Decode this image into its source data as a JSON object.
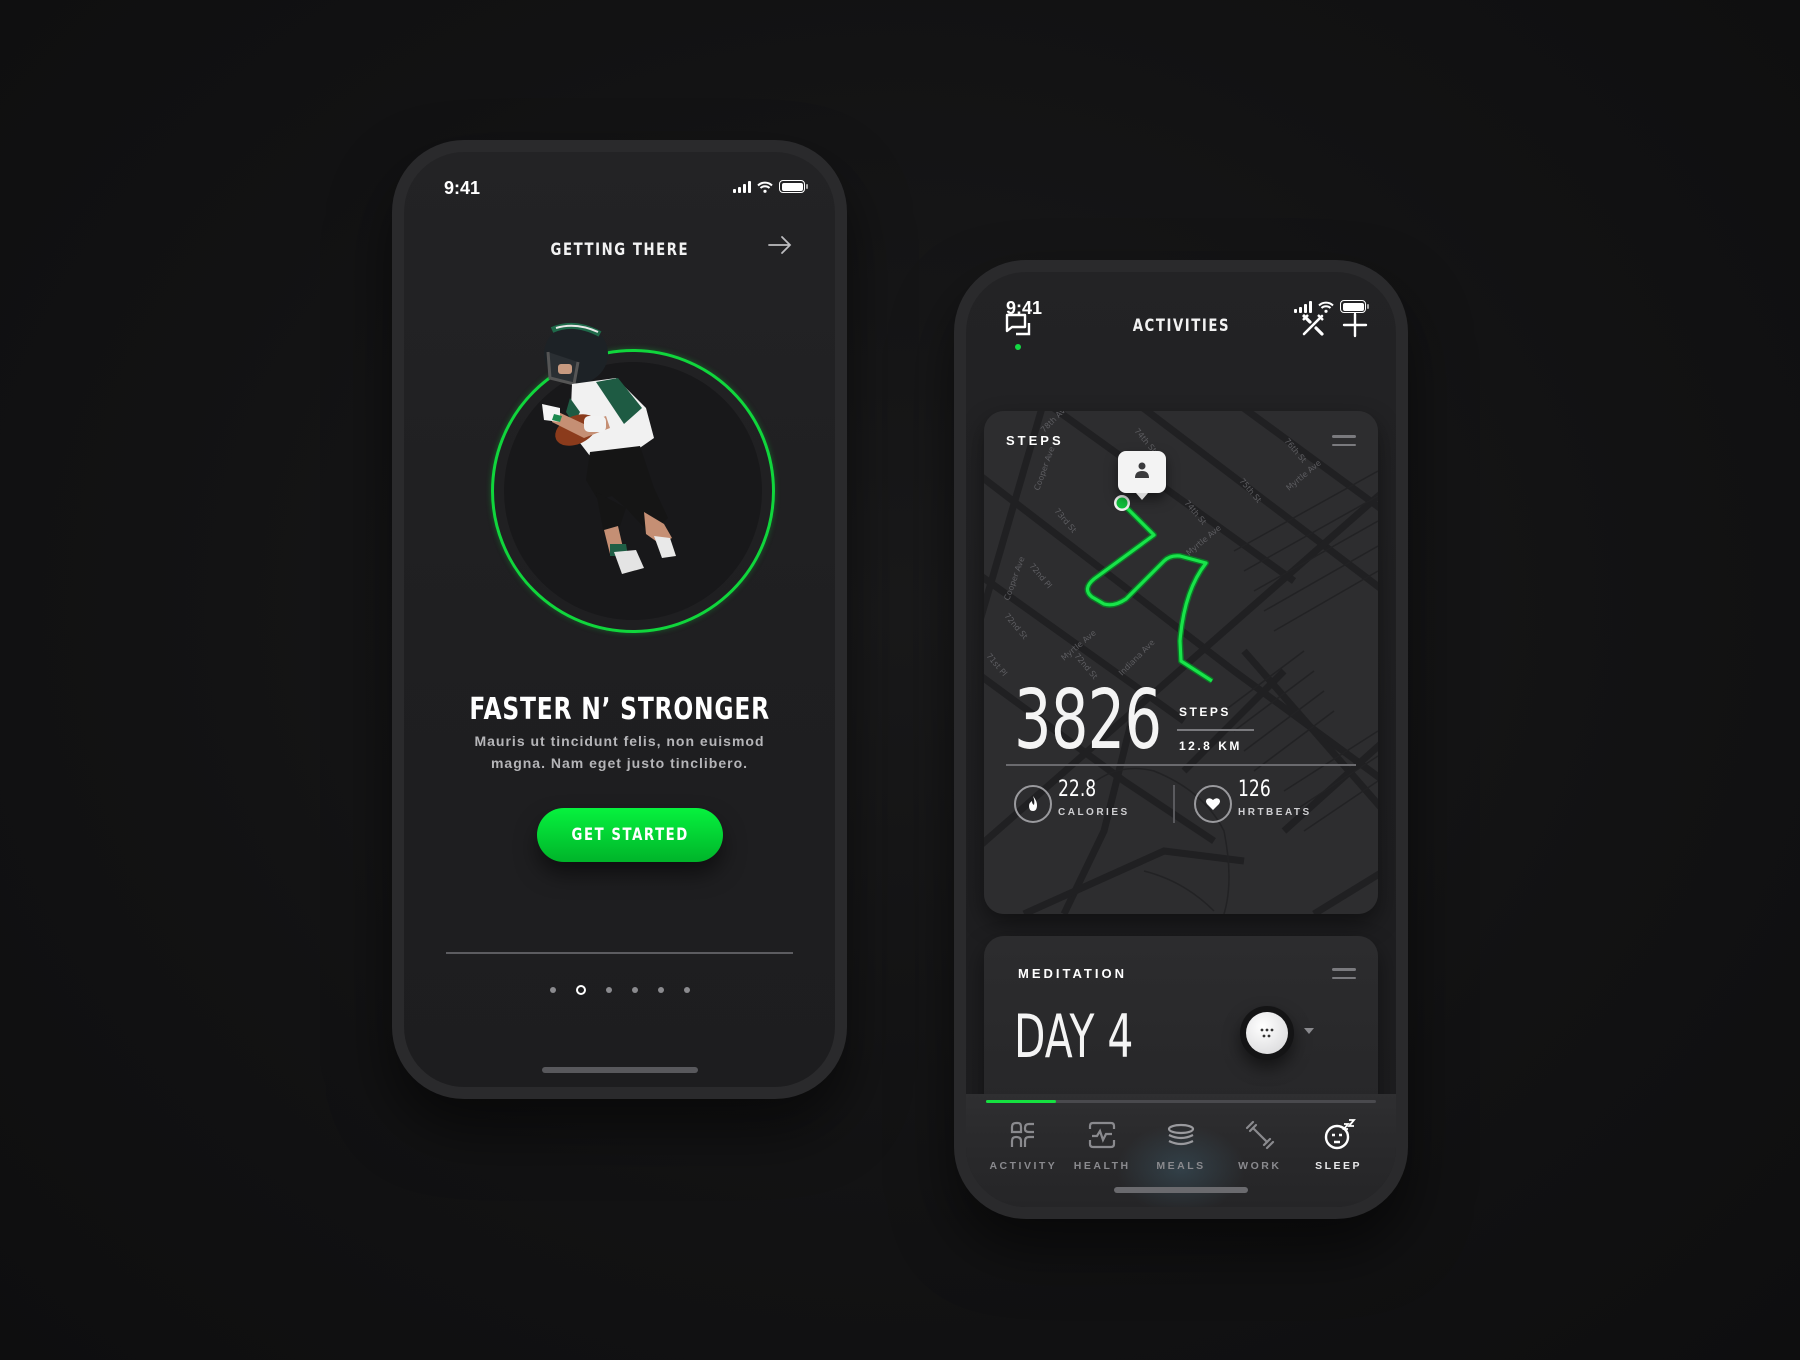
{
  "colors": {
    "accent": "#10d63c",
    "background": "#121213",
    "phone_body": "#2a2a2c",
    "card": "#2b2b2d"
  },
  "left_phone": {
    "status": {
      "time": "9:41",
      "icons": [
        "signal-icon",
        "wifi-icon",
        "battery-icon"
      ]
    },
    "header": {
      "title": "GETTING THERE",
      "next_icon": "arrow-right-icon"
    },
    "hero": {
      "image": "football-player-running",
      "ring_color": "#10d63c"
    },
    "heading": "FASTER N’ STRONGER",
    "body_line1": "Mauris ut tincidunt felis, non euismod",
    "body_line2": "magna. Nam eget justo tinclibero.",
    "cta_label": "GET STARTED",
    "pagination": {
      "total": 6,
      "active_index": 1
    }
  },
  "right_phone": {
    "status": {
      "time": "9:41",
      "icons": [
        "signal-icon",
        "wifi-icon",
        "battery-icon"
      ]
    },
    "header": {
      "title": "ACTIVITIES",
      "left_icon": "chat-icon",
      "right_icons": [
        "tools-icon",
        "plus-icon"
      ]
    },
    "steps_card": {
      "label": "STEPS",
      "map_streets": [
        "78th Ave",
        "74th St",
        "76th St",
        "75th St",
        "Myrtle Ave",
        "Cooper Ave",
        "73rd St",
        "73rd",
        "74th St",
        "72nd Pl",
        "72nd St",
        "71st Pl",
        "Indiana Ave",
        "Myrtle Ave",
        "72nd St",
        "Myrtle Ave"
      ],
      "steps_value": "3826",
      "steps_unit": "STEPS",
      "distance": "12.8 KM",
      "stats": [
        {
          "icon": "flame-icon",
          "value": "22.8",
          "label": "CALORIES"
        },
        {
          "icon": "heart-icon",
          "value": "126",
          "label": "HRTBEATS"
        }
      ]
    },
    "meditation_card": {
      "label": "MEDITATION",
      "day": "DAY 4"
    },
    "tabbar": {
      "progress": 0.18,
      "active_tab": "SLEEP",
      "tabs": [
        {
          "icon": "activity-icon",
          "label": "ACTIVITY"
        },
        {
          "icon": "health-icon",
          "label": "HEALTH"
        },
        {
          "icon": "meals-icon",
          "label": "MEALS"
        },
        {
          "icon": "work-icon",
          "label": "WORK"
        },
        {
          "icon": "sleep-icon",
          "label": "SLEEP"
        }
      ]
    }
  }
}
